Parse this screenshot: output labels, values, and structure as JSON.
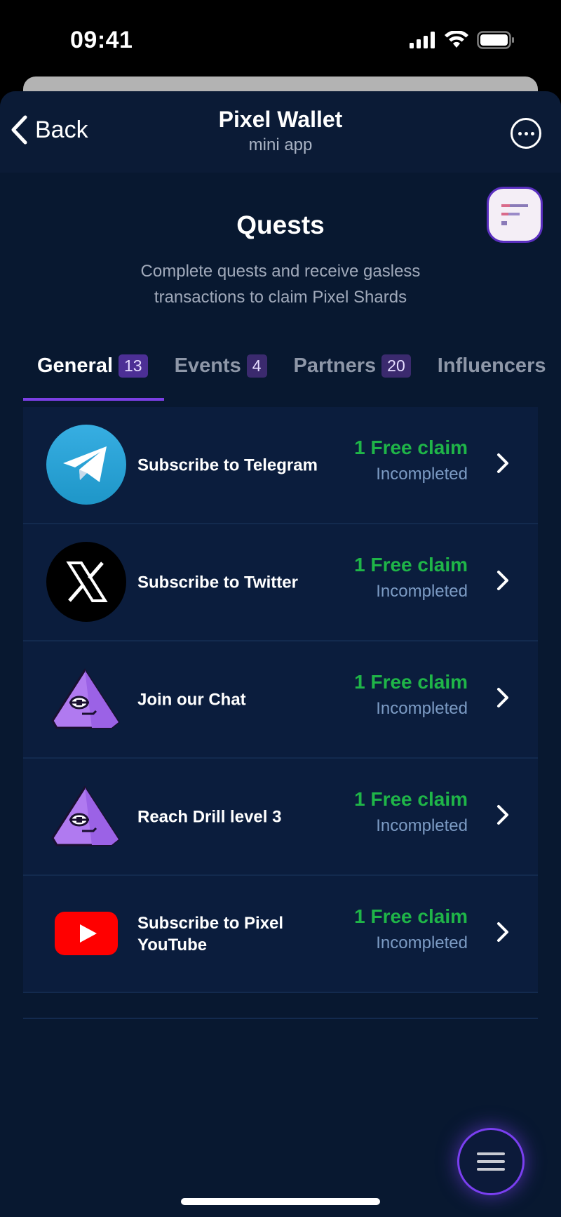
{
  "status": {
    "time": "09:41"
  },
  "header": {
    "back_label": "Back",
    "title": "Pixel Wallet",
    "subtitle": "mini app"
  },
  "page": {
    "title": "Quests",
    "description": "Complete quests and receive gasless transactions to claim Pixel Shards"
  },
  "tabs": [
    {
      "label": "General",
      "count": "13"
    },
    {
      "label": "Events",
      "count": "4"
    },
    {
      "label": "Partners",
      "count": "20"
    },
    {
      "label": "Influencers",
      "count": ""
    }
  ],
  "quests": [
    {
      "title": "Subscribe to Telegram",
      "reward": "1 Free claim",
      "status": "Incompleted",
      "icon": "telegram-icon"
    },
    {
      "title": "Subscribe to Twitter",
      "reward": "1 Free claim",
      "status": "Incompleted",
      "icon": "x-twitter-icon"
    },
    {
      "title": "Join our Chat",
      "reward": "1 Free claim",
      "status": "Incompleted",
      "icon": "pixel-mascot-icon"
    },
    {
      "title": "Reach Drill level 3",
      "reward": "1 Free claim",
      "status": "Incompleted",
      "icon": "pixel-mascot-icon"
    },
    {
      "title": "Subscribe to Pixel YouTube",
      "reward": "1 Free claim",
      "status": "Incompleted",
      "icon": "youtube-icon"
    }
  ],
  "colors": {
    "accent": "#7b3fe4",
    "reward_green": "#1fb548",
    "background": "#081830"
  }
}
